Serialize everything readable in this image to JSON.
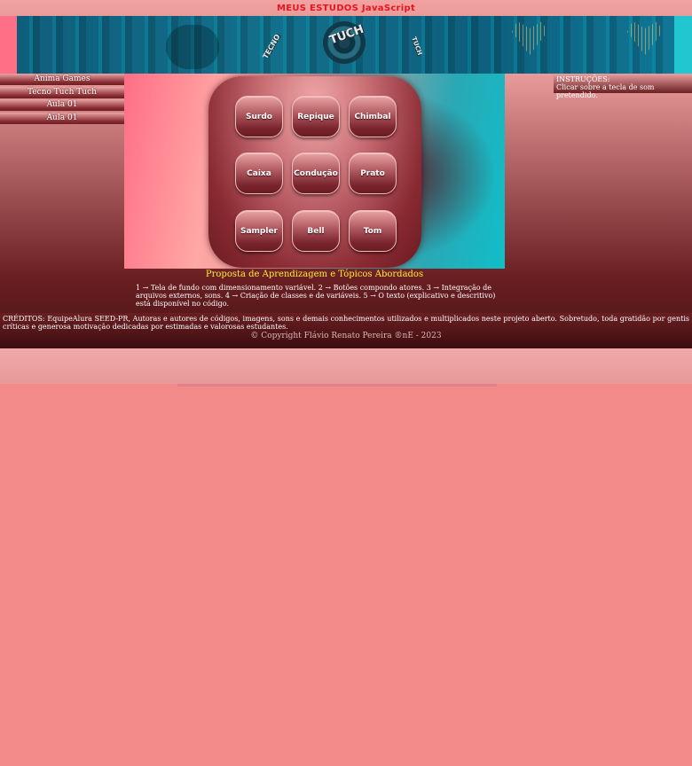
{
  "header": {
    "title": "MEUS ESTUDOS JavaScript"
  },
  "banner": {
    "words": [
      "TECNO",
      "TUCH",
      "TUCH"
    ]
  },
  "sidebar": {
    "items": [
      {
        "label": "Anima Games"
      },
      {
        "label": "Tecno Tuch Tuch"
      },
      {
        "label": "Aula 01"
      },
      {
        "label": "Aula 01"
      }
    ]
  },
  "pad": {
    "buttons": [
      {
        "label": "Surdo"
      },
      {
        "label": "Repique"
      },
      {
        "label": "Chimbal"
      },
      {
        "label": "Caixa"
      },
      {
        "label": "Condução"
      },
      {
        "label": "Prato"
      },
      {
        "label": "Sampler"
      },
      {
        "label": "Bell"
      },
      {
        "label": "Tom"
      }
    ]
  },
  "instructions": {
    "title": "INSTRUÇÕES:",
    "text": "Clicar sobre a tecla de som pretendido."
  },
  "proposta": {
    "title": "Proposta de Aprendizagem e Tópicos Abordados",
    "text": "1 → Tela de fundo com dimensionamento variável. 2 → Botões compondo atores. 3 → Integração de arquivos externos, sons. 4 → Criação de classes e de variáveis. 5 → O texto (explicativo e descritivo) está disponível no código."
  },
  "footer": {
    "credits": "CRÉDITOS: EquipeAlura SEED-PR, Autoras e autores de códigos, imagens, sons e demais conhecimentos utilizados e multiplicados neste projeto aberto. Sobretudo, toda gratidão por gentis críticas e generosa motivação dedicadas por estimadas e valorosas estudantes.",
    "copyright": "© Copyright Flávio Renato Pereira ®nE - 2023"
  },
  "colors": {
    "title_red": "#e8141f",
    "proposta_yellow": "#ffec3a",
    "background": "#f48b8b"
  }
}
